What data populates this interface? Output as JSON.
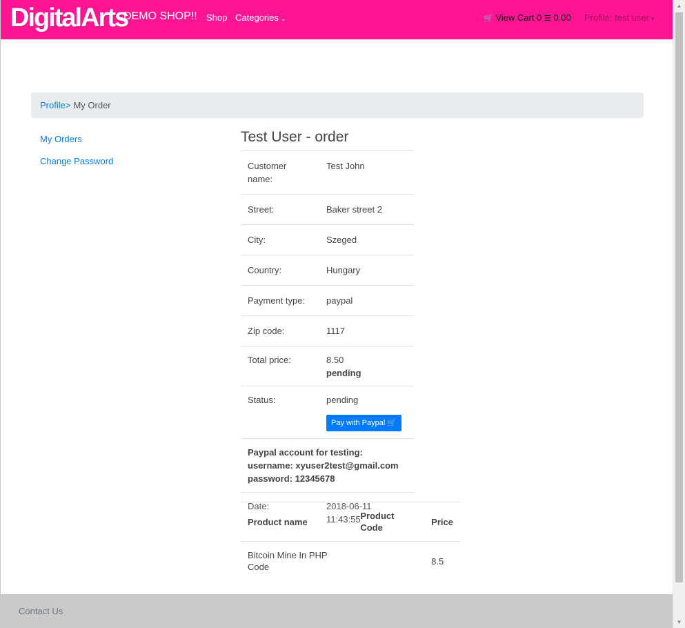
{
  "navbar": {
    "logo": "DigitalArts",
    "brand_sub": "DEMO SHOP!!",
    "shop": "Shop",
    "categories": "Categories",
    "cart_label": "View Cart 0",
    "cart_total": "0.00",
    "profile": "Profile: test user",
    "color": "#ff1493"
  },
  "breadcrumb": {
    "profile": "Profile",
    "separator": ">",
    "current": "My Order"
  },
  "sidebar": {
    "orders": "My Orders",
    "password": "Change Password"
  },
  "order": {
    "title": "Test User - order",
    "rows": [
      {
        "label": "Customer name:",
        "value": "Test John"
      },
      {
        "label": "Street:",
        "value": "Baker street 2"
      },
      {
        "label": "City:",
        "value": "Szeged"
      },
      {
        "label": "Country:",
        "value": "Hungary"
      },
      {
        "label": "Payment type:",
        "value": "paypal"
      },
      {
        "label": "Zip code:",
        "value": "1117"
      }
    ],
    "total_label": "Total price:",
    "total_value": "8.50",
    "total_status": "pending",
    "status_label": "Status:",
    "status_value": "pending",
    "pay_button": "Pay with Paypal",
    "paypal_line1": "Paypal account for testing:",
    "paypal_line2": "username: xyuser2test@gmail.com",
    "paypal_line3": "password: 12345678",
    "date_label": "Date:",
    "date_value": "2018-06-11 11:43:55"
  },
  "products": {
    "headers": [
      "Product name",
      "Product Code",
      "Price"
    ],
    "rows": [
      [
        "Bitcoin Mine In PHP Code",
        "",
        "8.5"
      ]
    ]
  },
  "footer": {
    "contact": "Contact Us"
  },
  "colors": {
    "link": "#007bff",
    "button": "#007bff",
    "footer": "#cacaca"
  }
}
